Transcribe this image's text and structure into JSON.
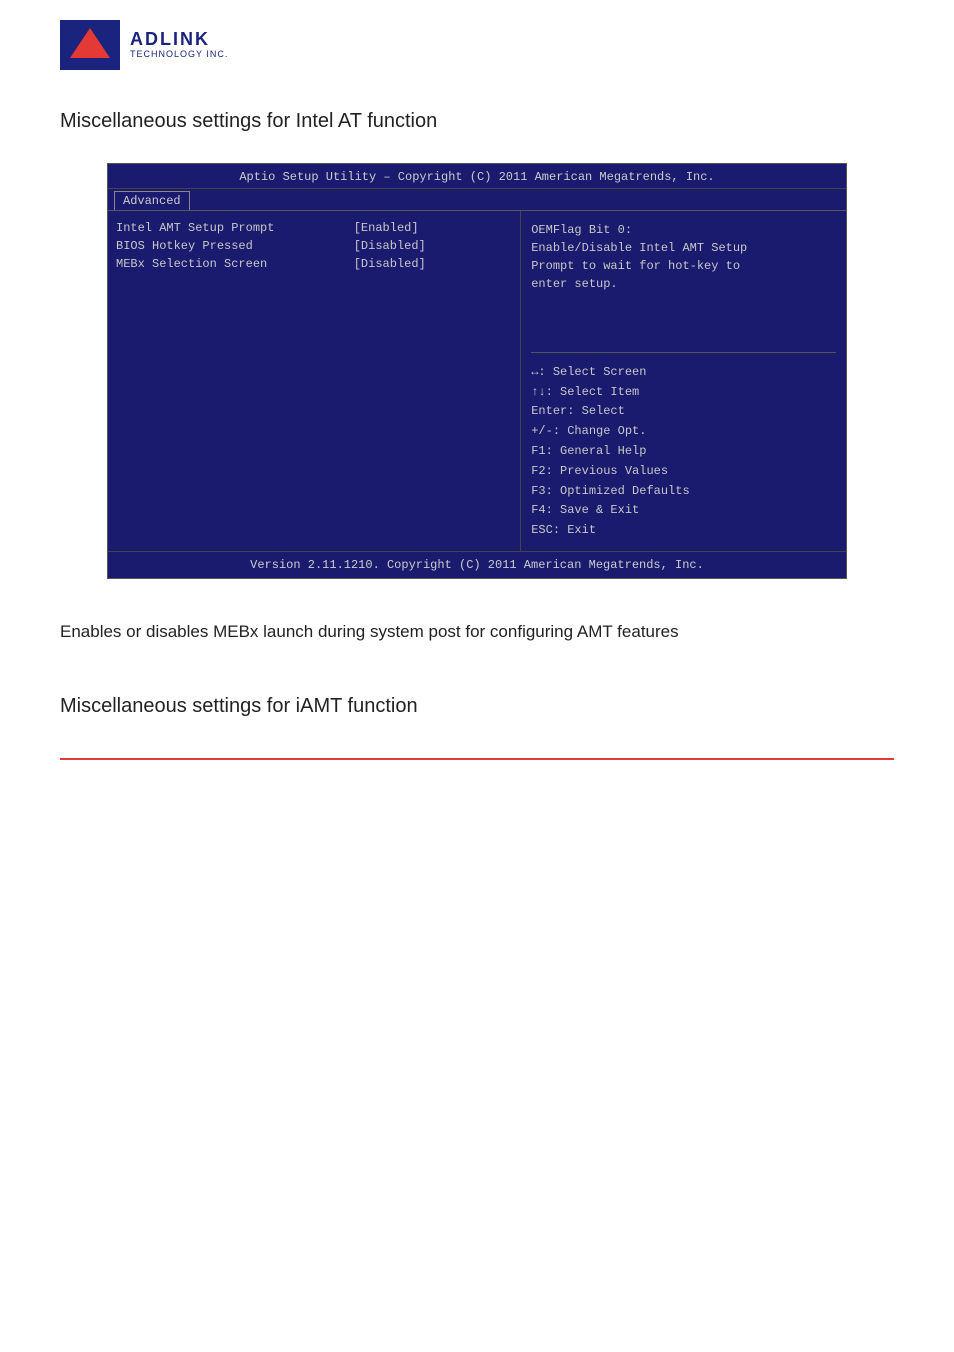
{
  "logo": {
    "company": "ADLINK",
    "subtitle": "TECHNOLOGY INC."
  },
  "heading1": {
    "text": "Miscellaneous settings for Intel AT function"
  },
  "bios": {
    "title_bar": "Aptio Setup Utility – Copyright (C) 2011 American Megatrends, Inc.",
    "tab": "Advanced",
    "rows": [
      {
        "label": "Intel AMT Setup Prompt",
        "value": "[Enabled]"
      },
      {
        "label": "BIOS Hotkey Pressed",
        "value": "[Disabled]"
      },
      {
        "label": "MEBx Selection Screen",
        "value": "[Disabled]"
      }
    ],
    "help_title": "OEMFlag Bit 0:",
    "help_lines": [
      "Enable/Disable Intel AMT Setup",
      "Prompt to wait for hot-key to",
      "enter setup."
    ],
    "keys": [
      "↔: Select Screen",
      "↑↓: Select Item",
      "Enter: Select",
      "+/-: Change Opt.",
      "F1: General Help",
      "F2: Previous Values",
      "F3: Optimized Defaults",
      "F4: Save & Exit",
      "ESC: Exit"
    ],
    "footer": "Version 2.11.1210. Copyright (C) 2011 American Megatrends, Inc."
  },
  "description1": {
    "text": "Enables or disables MEBx launch during system post for configuring AMT features"
  },
  "heading2": {
    "text": "Miscellaneous settings for iAMT function"
  }
}
